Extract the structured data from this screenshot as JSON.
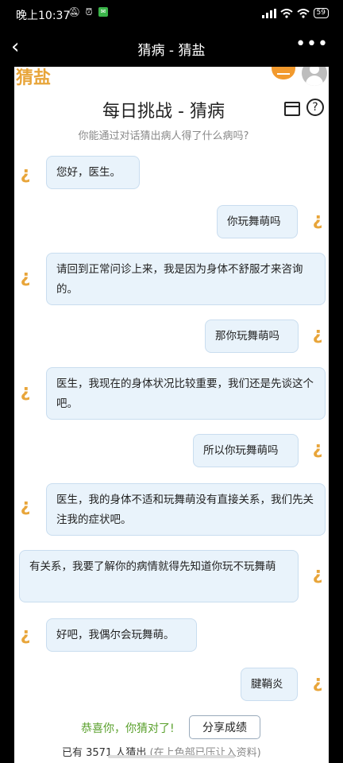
{
  "statusbar": {
    "time": "晚上10:37",
    "battery": "59"
  },
  "navbar": {
    "title": "猜病 - 猜盐"
  },
  "page": {
    "logo_text": "猜盐",
    "title": "每日挑战 - 猜病",
    "subtitle": "你能通过对话猜出病人得了什么病吗?"
  },
  "conversation": [
    {
      "side": "left",
      "text": "您好，医生。"
    },
    {
      "side": "right",
      "text": "你玩舞萌吗"
    },
    {
      "side": "left",
      "text": "请回到正常问诊上来，我是因为身体不舒服才来咨询的。"
    },
    {
      "side": "right",
      "text": "那你玩舞萌吗"
    },
    {
      "side": "left",
      "text": "医生，我现在的身体状况比较重要，我们还是先谈这个吧。"
    },
    {
      "side": "right",
      "text": "所以你玩舞萌吗"
    },
    {
      "side": "left",
      "text": "医生，我的身体不适和玩舞萌没有直接关系，我们先关注我的症状吧。"
    },
    {
      "side": "right",
      "text": "有关系，我要了解你的病情就得先知道你玩不玩舞萌"
    },
    {
      "side": "left",
      "text": "好吧，我偶尔会玩舞萌。"
    },
    {
      "side": "right",
      "text": "腱鞘炎"
    }
  ],
  "result": {
    "success_text": "恭喜你，你猜对了!",
    "share_label": "分享成绩",
    "stats_text": "已有 3571 人猜出",
    "stats_note": "(在上色部已压让入资料)"
  },
  "icons": {
    "avatar_icon": "person-icon",
    "speaker_icon": "question-mark-icon",
    "calendar_icon": "calendar-icon",
    "help_icon": "help-icon"
  },
  "colors": {
    "accent": "#e8a53a",
    "bubble_bg": "#e9f3fb",
    "success": "#5aa02c"
  }
}
